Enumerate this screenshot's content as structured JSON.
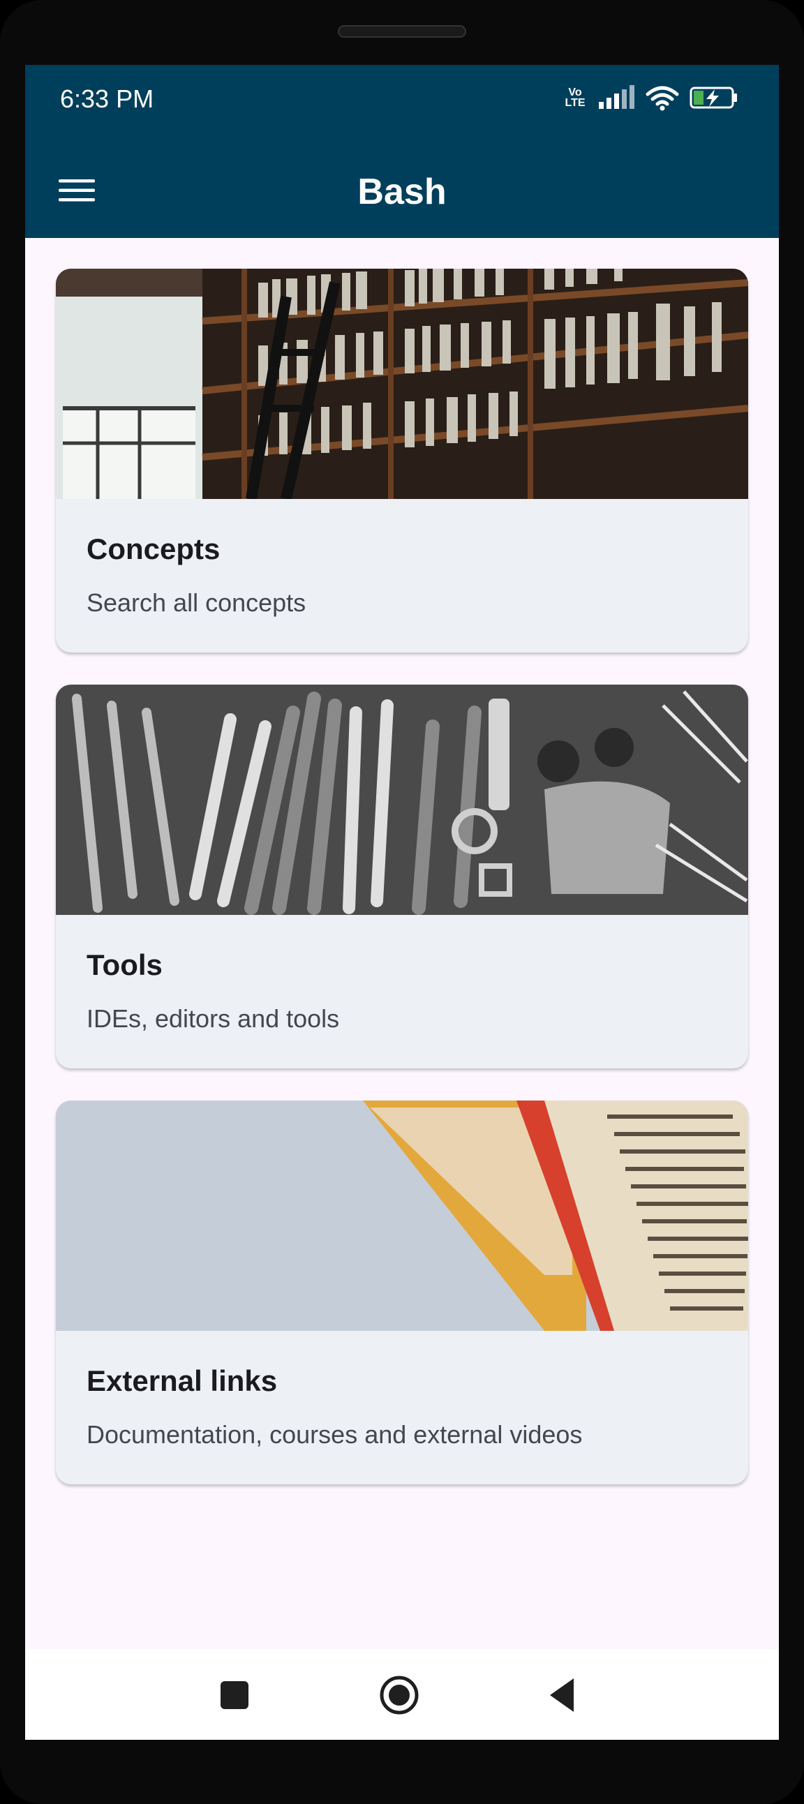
{
  "status_bar": {
    "time": "6:33 PM",
    "network_label": "Vo LTE"
  },
  "app_bar": {
    "title": "Bash",
    "menu_icon": "hamburger-menu-icon"
  },
  "cards": [
    {
      "title": "Concepts",
      "subtitle": "Search all concepts",
      "image": "library-bookshelf-photo"
    },
    {
      "title": "Tools",
      "subtitle": "IDEs, editors and tools",
      "image": "workbench-tools-photo"
    },
    {
      "title": "External links",
      "subtitle": "Documentation, courses and external videos",
      "image": "open-book-photo"
    }
  ],
  "colors": {
    "app_bar": "#003f5c",
    "background": "#fdf6fe",
    "card": "#edf0f5"
  },
  "nav_bar": {
    "icons": [
      "recents-square-icon",
      "home-circle-icon",
      "back-triangle-icon"
    ]
  }
}
